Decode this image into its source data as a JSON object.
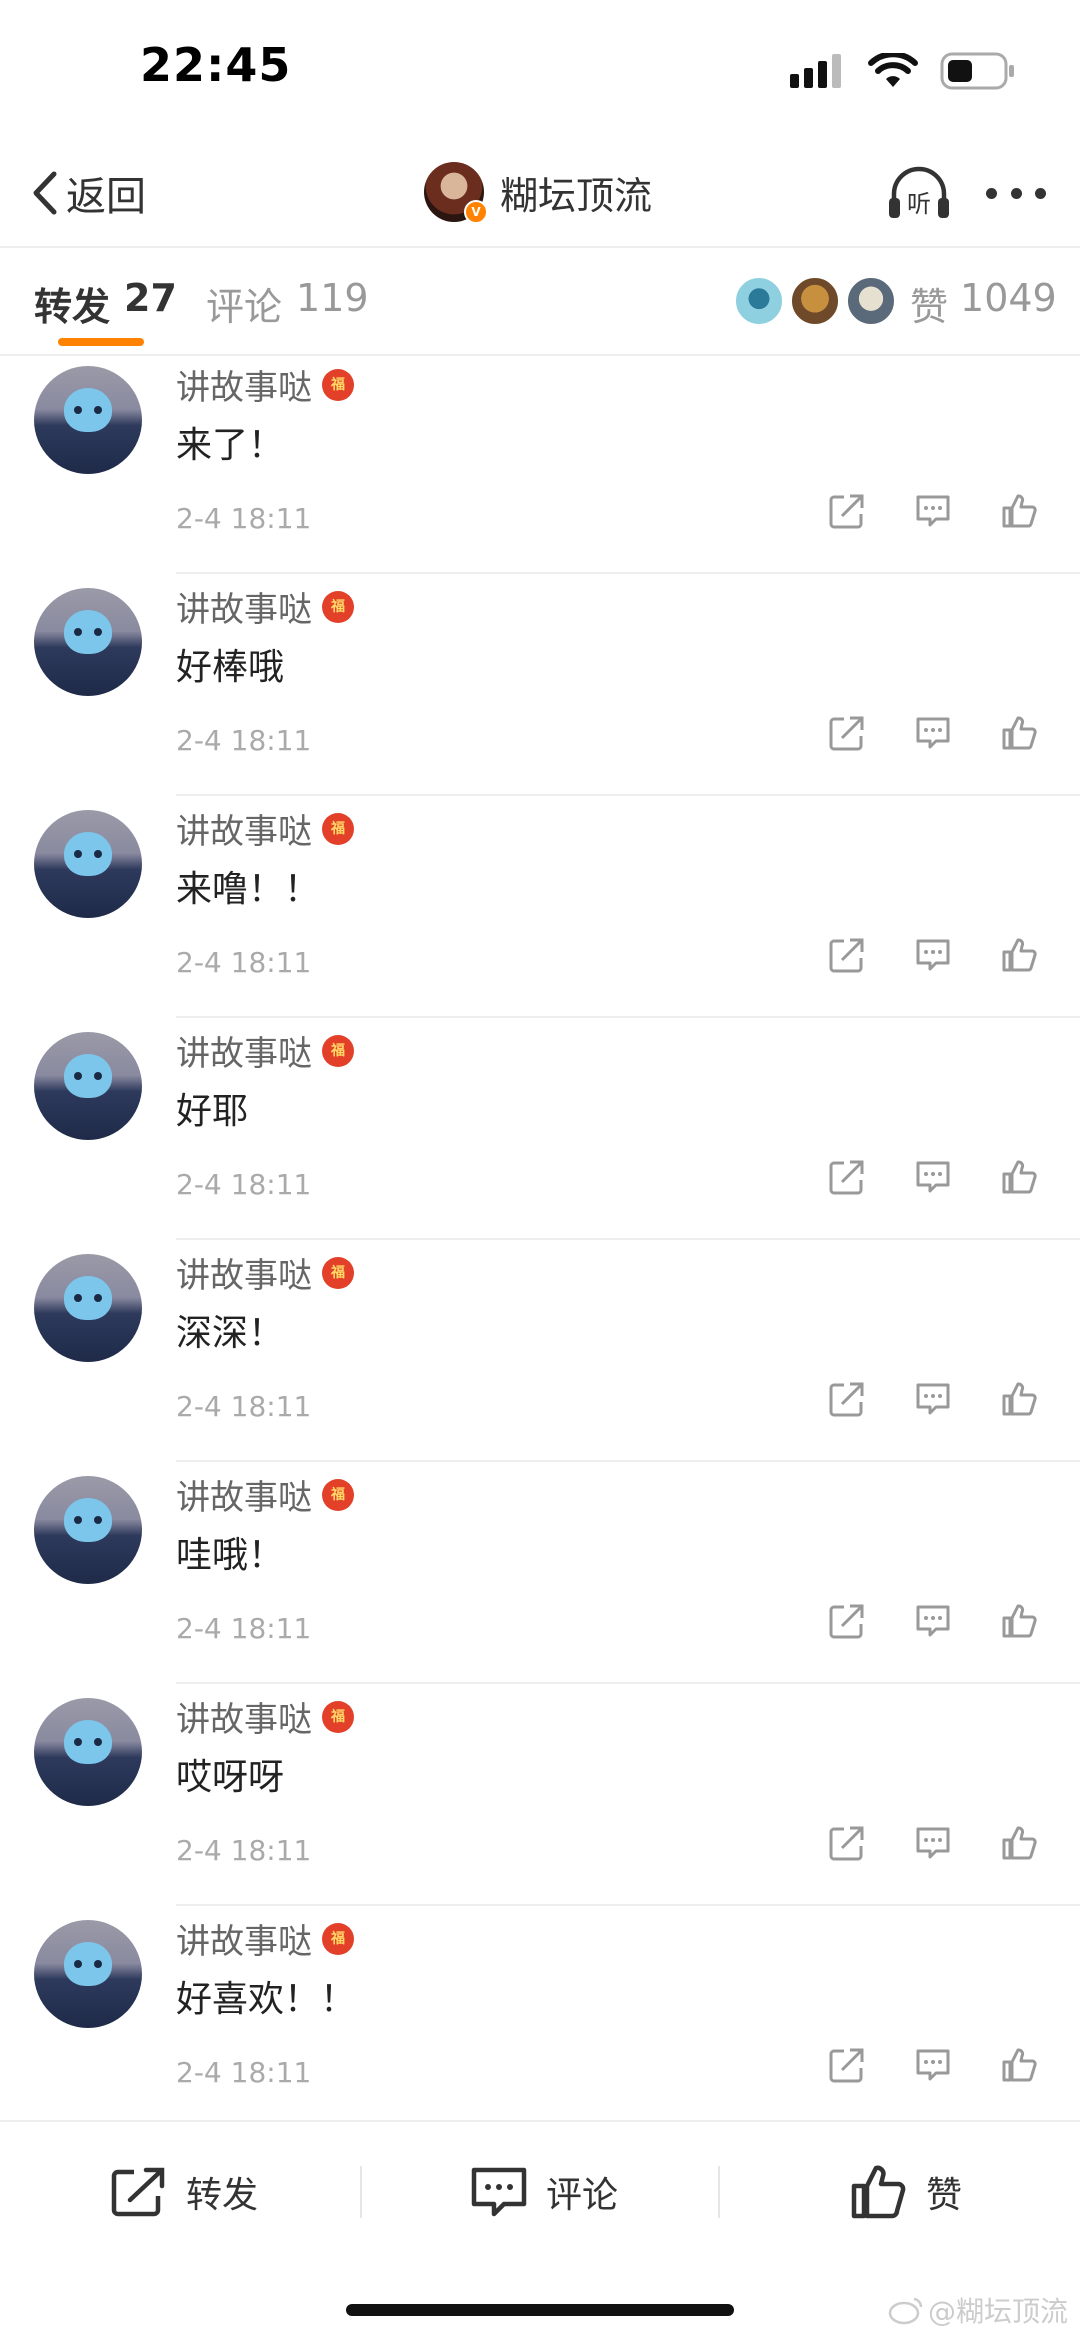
{
  "status_bar": {
    "time": "22:45",
    "icons": [
      "signal-icon",
      "wifi-icon",
      "battery-icon"
    ]
  },
  "nav": {
    "back_label": "返回",
    "title": "糊坛顶流",
    "listen_label": "听",
    "more_icon": "more-icon"
  },
  "tabs": {
    "repost_label": "转发",
    "repost_count": "27",
    "comment_label": "评论",
    "comment_count": "119",
    "likes_label": "赞",
    "likes_count": "1049"
  },
  "comments": [
    {
      "user": "讲故事哒",
      "text": "来了！",
      "time": "2-4 18:11"
    },
    {
      "user": "讲故事哒",
      "text": "好棒哦",
      "time": "2-4 18:11"
    },
    {
      "user": "讲故事哒",
      "text": "来噜！！",
      "time": "2-4 18:11"
    },
    {
      "user": "讲故事哒",
      "text": "好耶",
      "time": "2-4 18:11"
    },
    {
      "user": "讲故事哒",
      "text": "深深！",
      "time": "2-4 18:11"
    },
    {
      "user": "讲故事哒",
      "text": "哇哦！",
      "time": "2-4 18:11"
    },
    {
      "user": "讲故事哒",
      "text": "哎呀呀",
      "time": "2-4 18:11"
    },
    {
      "user": "讲故事哒",
      "text": "好喜欢！！",
      "time": "2-4 18:11"
    }
  ],
  "toolbar": {
    "repost_label": "转发",
    "comment_label": "评论",
    "like_label": "赞"
  },
  "watermark": "@糊坛顶流",
  "colors": {
    "accent": "#ff8200",
    "vip_badge": "#e3402a",
    "text_primary": "#333333",
    "text_secondary": "#999999"
  }
}
